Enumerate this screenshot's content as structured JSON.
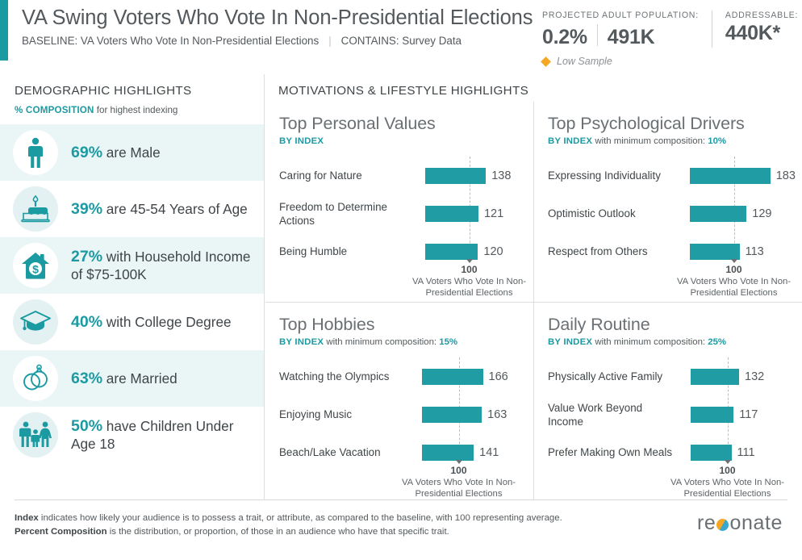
{
  "header": {
    "title": "VA Swing Voters Who Vote In Non-Presidential Elections",
    "baseline_label": "BASELINE: VA Voters Who Vote In Non-Presidential Elections",
    "contains_label": "CONTAINS: Survey Data",
    "separator": "|",
    "projected_label": "PROJECTED ADULT POPULATION:",
    "projected_pct": "0.2%",
    "projected_count": "491K",
    "addressable_label": "ADDRESSABLE:",
    "addressable_count": "440K*",
    "low_sample": "Low Sample",
    "low_sample_icon": "diamond-icon",
    "accent_color": "#1c9aa2",
    "warning_color": "#f5a623"
  },
  "sidebar": {
    "title": "DEMOGRAPHIC HIGHLIGHTS",
    "sub_strong": "% COMPOSITION",
    "sub_rest": " for highest indexing",
    "items": [
      {
        "pct": "69%",
        "text": " are Male",
        "icon": "male-person-icon",
        "shaded": true
      },
      {
        "pct": "39%",
        "text": " are 45-54 Years of Age",
        "icon": "birthday-cake-icon",
        "shaded": false
      },
      {
        "pct": "27%",
        "text": " with Household Income of $75-100K",
        "icon": "house-dollar-icon",
        "shaded": true
      },
      {
        "pct": "40%",
        "text": " with College Degree",
        "icon": "graduation-cap-icon",
        "shaded": false
      },
      {
        "pct": "63%",
        "text": " are Married",
        "icon": "wedding-rings-icon",
        "shaded": true
      },
      {
        "pct": "50%",
        "text": " have Children Under Age 18",
        "icon": "family-icon",
        "shaded": false
      }
    ]
  },
  "main": {
    "title": "MOTIVATIONS & LIFESTYLE HIGHLIGHTS"
  },
  "chart_data": [
    {
      "type": "bar",
      "title": "Top Personal Values",
      "sub_strong": "BY INDEX",
      "sub_rest": "",
      "sub_highlight": "",
      "categories": [
        "Caring for Nature",
        "Freedom to Determine Actions",
        "Being Humble"
      ],
      "values": [
        138,
        121,
        120
      ],
      "baseline": 100,
      "baseline_label": "100",
      "baseline_caption": "VA Voters Who Vote In Non-Presidential Elections",
      "xlabel": "",
      "ylabel": "",
      "grid": false,
      "legend": "none"
    },
    {
      "type": "bar",
      "title": "Top Psychological Drivers",
      "sub_strong": "BY INDEX",
      "sub_rest": " with minimum composition: ",
      "sub_highlight": "10%",
      "categories": [
        "Expressing Individuality",
        "Optimistic Outlook",
        "Respect from Others"
      ],
      "values": [
        183,
        129,
        113
      ],
      "baseline": 100,
      "baseline_label": "100",
      "baseline_caption": "VA Voters Who Vote In Non-Presidential Elections",
      "xlabel": "",
      "ylabel": "",
      "grid": false,
      "legend": "none"
    },
    {
      "type": "bar",
      "title": "Top Hobbies",
      "sub_strong": "BY INDEX",
      "sub_rest": " with minimum composition: ",
      "sub_highlight": "15%",
      "categories": [
        "Watching the Olympics",
        "Enjoying Music",
        "Beach/Lake Vacation"
      ],
      "values": [
        166,
        163,
        141
      ],
      "baseline": 100,
      "baseline_label": "100",
      "baseline_caption": "VA Voters Who Vote In Non-Presidential Elections",
      "xlabel": "",
      "ylabel": "",
      "grid": false,
      "legend": "none"
    },
    {
      "type": "bar",
      "title": "Daily Routine",
      "sub_strong": "BY INDEX",
      "sub_rest": " with minimum composition: ",
      "sub_highlight": "25%",
      "categories": [
        "Physically Active Family",
        "Value Work Beyond Income",
        "Prefer Making Own Meals"
      ],
      "values": [
        132,
        117,
        111
      ],
      "baseline": 100,
      "baseline_label": "100",
      "baseline_caption": "VA Voters Who Vote In Non-Presidential Elections",
      "xlabel": "",
      "ylabel": "",
      "grid": false,
      "legend": "none"
    }
  ],
  "footer": {
    "line1_strong": "Index",
    "line1_rest": " indicates how likely your audience is to possess a trait, or attribute, as compared to the baseline, with 100 representing average.",
    "line2_strong": "Percent Composition",
    "line2_rest": " is the distribution, or proportion, of those in an audience who have that specific trait.",
    "logo_part1": "re",
    "logo_part2": "onate"
  }
}
